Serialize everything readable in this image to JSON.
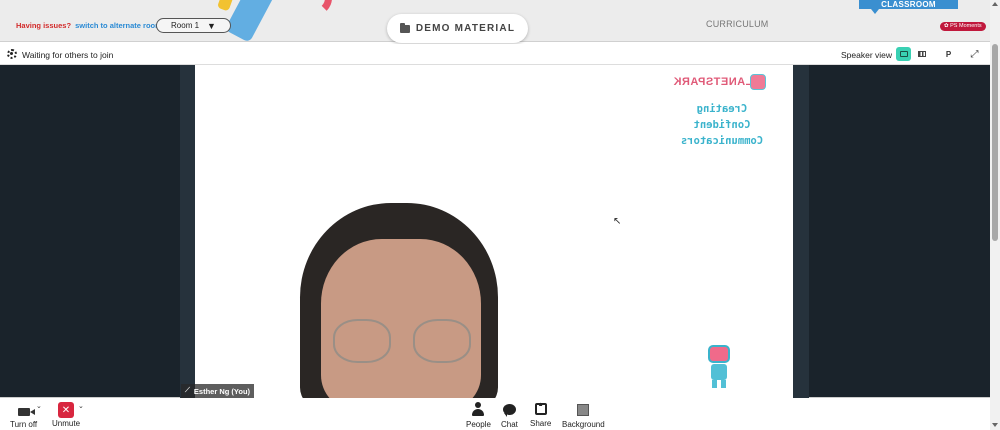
{
  "topbar": {
    "issues_question": "Having issues?",
    "issues_link": "switch to alternate room",
    "room_select_value": "Room 1",
    "room_caret": "▼",
    "demo_tab_label": "DEMO MATERIAL",
    "curriculum_tab_label": "CURRICULUM",
    "classroom_tab_label": "CLASSROOM",
    "moments_label": "PS Moments"
  },
  "meeting_header": {
    "status_text": "Waiting for others to join",
    "view_label": "Speaker view",
    "p_button_label": "P",
    "fullscreen_glyph": "⤢"
  },
  "video": {
    "brand_text": "PLANETSPARK",
    "tagline_lines": [
      "Creating",
      "Confident",
      "Communicators"
    ],
    "participant_name": "Esther Ng (You)",
    "participant_mic_glyph": "🎤"
  },
  "toolbar": {
    "camera_label": "Turn off",
    "mic_label": "Unmute",
    "mic_glyph": "✕",
    "chevron_glyph": "⌄",
    "people_label": "People",
    "chat_label": "Chat",
    "share_label": "Share",
    "background_label": "Background"
  },
  "colors": {
    "stage_background": "#1a232b",
    "accent_speaker_view": "#39d0b3",
    "mic_muted": "#d8263f",
    "classroom_tab": "#3a8fd0",
    "moments_badge": "#c0183c",
    "issues_red": "#d22a2a",
    "issues_link_blue": "#2a8ad4",
    "tagline_cyan": "#3ab3cc"
  },
  "icons": [
    "gear-icon",
    "speaker-view-icon",
    "grid-view-icon",
    "fullscreen-icon",
    "folder-icon",
    "camera-icon",
    "mic-off-icon",
    "people-icon",
    "chat-icon",
    "share-icon",
    "background-icon"
  ]
}
